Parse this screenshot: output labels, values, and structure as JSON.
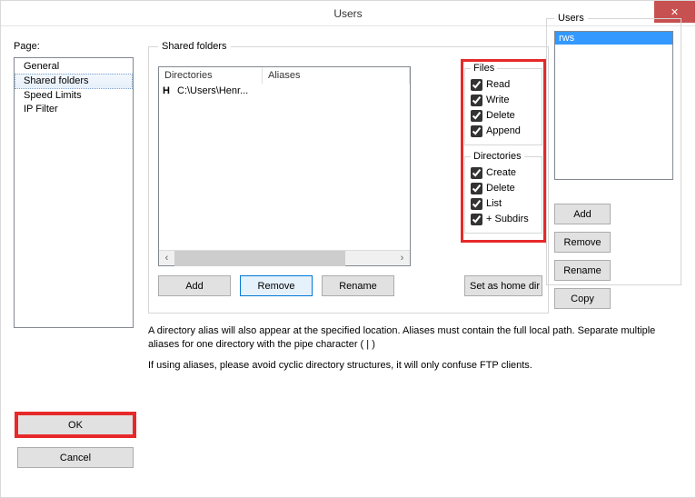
{
  "window": {
    "title": "Users"
  },
  "page": {
    "label": "Page:",
    "items": [
      "General",
      "Shared folders",
      "Speed Limits",
      "IP Filter"
    ],
    "selected_index": 1
  },
  "shared": {
    "legend": "Shared folders",
    "col1": "Directories",
    "col2": "Aliases",
    "rows": [
      {
        "flag": "H",
        "path": "C:\\Users\\Henr..."
      }
    ],
    "add": "Add",
    "remove": "Remove",
    "rename": "Rename",
    "set_home": "Set as home dir"
  },
  "perms": {
    "files_legend": "Files",
    "read": "Read",
    "write": "Write",
    "delete": "Delete",
    "append": "Append",
    "dirs_legend": "Directories",
    "create": "Create",
    "ddelete": "Delete",
    "list": "List",
    "subdirs": "+ Subdirs"
  },
  "users": {
    "legend": "Users",
    "items": [
      "rws"
    ],
    "add": "Add",
    "remove": "Remove",
    "rename": "Rename",
    "copy": "Copy"
  },
  "help": {
    "p1": "A directory alias will also appear at the specified location. Aliases must contain the full local path. Separate multiple aliases for one directory with the pipe character ( | )",
    "p2": "If using aliases, please avoid cyclic directory structures, it will only confuse FTP clients."
  },
  "ok": "OK",
  "cancel": "Cancel"
}
